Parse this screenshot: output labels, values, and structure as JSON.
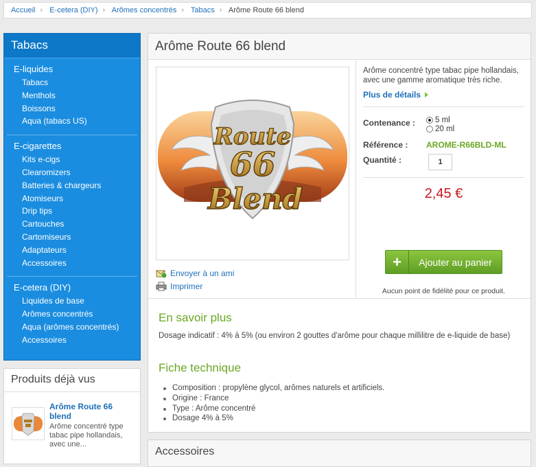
{
  "breadcrumb": [
    "Accueil",
    "E-cetera (DIY)",
    "Arômes concentrés",
    "Tabacs",
    "Arôme Route 66 blend"
  ],
  "sidebar": {
    "title": "Tabacs",
    "groups": [
      {
        "title": "E-liquides",
        "items": [
          "Tabacs",
          "Menthols",
          "Boissons",
          "Aqua (tabacs US)"
        ]
      },
      {
        "title": "E-cigarettes",
        "items": [
          "Kits e-cigs",
          "Clearomizers",
          "Batteries & chargeurs",
          "Atomiseurs",
          "Drip tips",
          "Cartouches",
          "Cartomiseurs",
          "Adaptateurs",
          "Accessoires"
        ]
      },
      {
        "title": "E-cetera (DIY)",
        "items": [
          "Liquides de base",
          "Arômes concentrés",
          "Aqua (arômes concentrés)",
          "Accessoires"
        ]
      }
    ]
  },
  "seen": {
    "title": "Produits déjà vus",
    "item": {
      "name": "Arôme Route 66 blend",
      "desc": "Arôme concentré type tabac pipe hollandais, avec une..."
    }
  },
  "product": {
    "title": "Arôme Route 66 blend",
    "image_text": {
      "route": "Route",
      "num": "66",
      "blend": "Blend"
    },
    "short_desc": "Arôme concentré type tabac pipe hollandais, avec une gamme aromatique très riche.",
    "more_link": "Plus de détails",
    "contenance_label": "Contenance :",
    "options": [
      "5 ml",
      "20 ml"
    ],
    "selected_option": "5 ml",
    "ref_label": "Référence :",
    "ref_value": "AROME-R66BLD-ML",
    "qty_label": "Quantité :",
    "qty_value": "1",
    "price": "2,45 €",
    "cart_button": "Ajouter au panier",
    "fidelity": "Aucun point de fidélité pour ce produit.",
    "actions": {
      "send": "Envoyer à un ami",
      "print": "Imprimer"
    },
    "more_title": "En savoir plus",
    "more_text": "Dosage indicatif : 4% à 5% (ou environ 2 gouttes d'arôme pour chaque millilitre de e-liquide de base)",
    "tech_title": "Fiche technique",
    "tech_items": [
      "Composition : propylène glycol, arômes naturels et artificiels.",
      "Origine : France",
      "Type : Arôme concentré",
      "Dosage 4% à 5%"
    ]
  },
  "accessories_title": "Accessoires",
  "colors": {
    "accent_blue": "#1a8de0",
    "price_red": "#c8161d",
    "green": "#6aa824"
  }
}
